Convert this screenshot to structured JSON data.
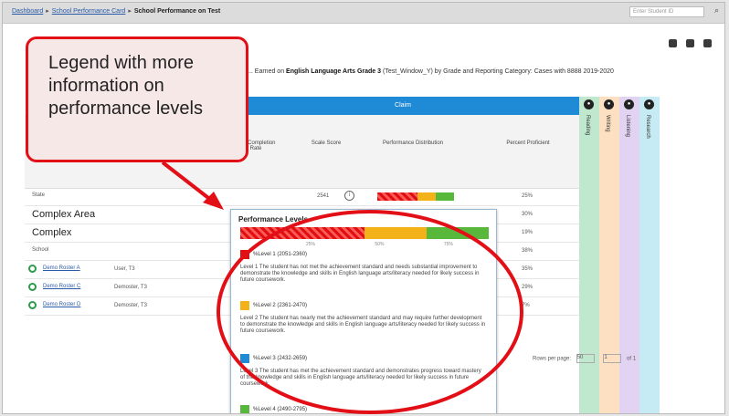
{
  "breadcrumb": {
    "items": [
      "Dashboard",
      "School Performance Card",
      "School Performance on Test"
    ]
  },
  "search": {
    "placeholder": "Enter Student ID"
  },
  "report": {
    "title_prefix": "... Earned on",
    "title_bold": "English Language Arts Grade 3",
    "title_suffix": "(Test_Window_Y) by Grade and Reporting Category: Cases with 8888 2019-2020"
  },
  "table": {
    "header_group": "Claim",
    "headers": [
      "Test Completion Rate",
      "Scale Score",
      "Performance Distribution",
      "Percent Proficient"
    ],
    "rows": [
      {
        "name": "State",
        "big": false,
        "score": "2541",
        "pct": "25%"
      },
      {
        "name": "Complex Area",
        "big": true,
        "pct": "30%"
      },
      {
        "name": "Complex",
        "big": true,
        "pct": "19%"
      },
      {
        "name": "School",
        "big": false,
        "pct": "38%"
      },
      {
        "name": "Demo Roster A",
        "teacher": "User, T3",
        "pct": "35%"
      },
      {
        "name": "Demo Roster C",
        "teacher": "Demoster, T3",
        "pct": "29%"
      },
      {
        "name": "Demo Roster D",
        "teacher": "Demoster, T3",
        "pct": "7%"
      }
    ]
  },
  "side_columns": [
    "Reading",
    "Writing",
    "Listening",
    "Research"
  ],
  "side_colors": [
    "#bfe8cf",
    "#fde0c2",
    "#e2d3f3",
    "#c7ebf4"
  ],
  "pager": {
    "rows_per_page_label": "Rows per page:",
    "rows_per_page": "50",
    "page": "1",
    "of": "of 1"
  },
  "popup": {
    "title": "Performance Levels",
    "ticks": [
      "25%",
      "50%",
      "75%"
    ],
    "levels": [
      {
        "label": "%Level 1 (2051-2360)",
        "color": "#e01010",
        "desc": "Level 1 The student has not met the achievement standard and needs substantial improvement to demonstrate the knowledge and skills in English language arts/literacy needed for likely success in future coursework."
      },
      {
        "label": "%Level 2 (2361-2470)",
        "color": "#f3b21a",
        "desc": "Level 2 The student has nearly met the achievement standard and may require further development to demonstrate the knowledge and skills in English language arts/literacy needed for likely success in future coursework."
      },
      {
        "label": "%Level 3 (2432-2659)",
        "color": "#1f8ad6",
        "desc": "Level 3 The student has met the achievement standard and demonstrates progress toward mastery of the knowledge and skills in English language arts/literacy needed for likely success in future coursework."
      },
      {
        "label": "%Level 4 (2490-2795)",
        "color": "#57b83b",
        "desc": ""
      }
    ]
  },
  "callout": {
    "text": "Legend with more information on performance levels"
  }
}
